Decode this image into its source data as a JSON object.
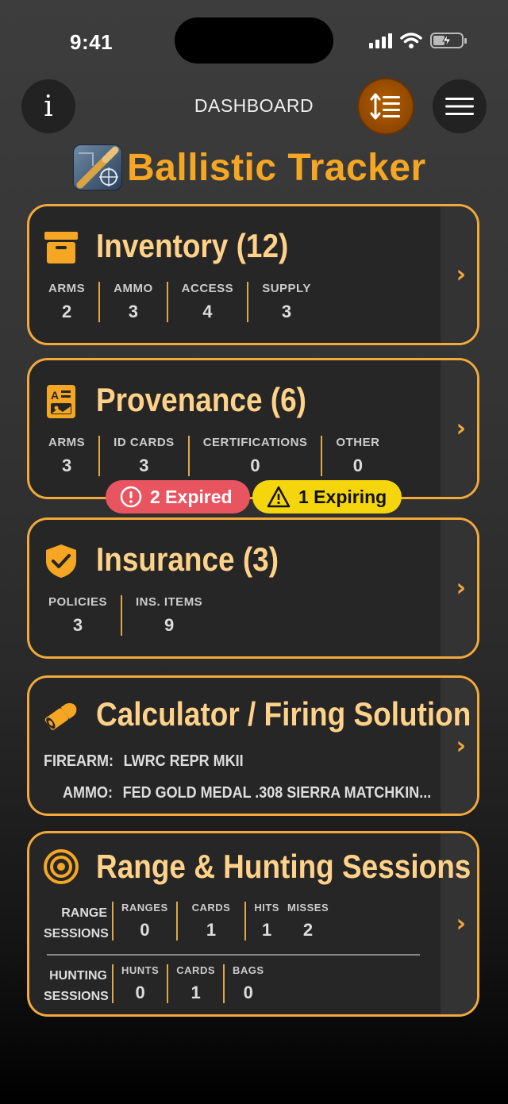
{
  "status": {
    "time": "9:41"
  },
  "nav": {
    "title": "DASHBOARD",
    "info_glyph": "i"
  },
  "app": {
    "title": "Ballistic Tracker"
  },
  "inventory": {
    "title": "Inventory (12)",
    "stats": [
      {
        "label": "ARMS",
        "value": "2"
      },
      {
        "label": "AMMO",
        "value": "3"
      },
      {
        "label": "ACCESS",
        "value": "4"
      },
      {
        "label": "SUPPLY",
        "value": "3"
      }
    ]
  },
  "provenance": {
    "title": "Provenance (6)",
    "stats": [
      {
        "label": "ARMS",
        "value": "3"
      },
      {
        "label": "ID CARDS",
        "value": "3"
      },
      {
        "label": "CERTIFICATIONS",
        "value": "0"
      },
      {
        "label": "OTHER",
        "value": "0"
      }
    ],
    "badges": {
      "expired": "2 Expired",
      "expiring": "1 Expiring"
    }
  },
  "insurance": {
    "title": "Insurance (3)",
    "stats": [
      {
        "label": "POLICIES",
        "value": "3"
      },
      {
        "label": "INS. ITEMS",
        "value": "9"
      }
    ]
  },
  "calculator": {
    "title": "Calculator / Firing Solution",
    "firearm_label": "FIREARM:",
    "firearm_value": "LWRC REPR MKII",
    "ammo_label": "AMMO:",
    "ammo_value": "FED GOLD MEDAL .308 SIERRA MATCHKIN..."
  },
  "sessions": {
    "title": "Range & Hunting Sessions",
    "range": {
      "label_line1": "RANGE",
      "label_line2": "SESSIONS",
      "stats": [
        {
          "label": "RANGES",
          "value": "0"
        },
        {
          "label": "CARDS",
          "value": "1"
        },
        {
          "label": "HITS",
          "value": "1"
        },
        {
          "label": "MISSES",
          "value": "2"
        }
      ]
    },
    "hunting": {
      "label_line1": "HUNTING",
      "label_line2": "SESSIONS",
      "stats": [
        {
          "label": "HUNTS",
          "value": "0"
        },
        {
          "label": "CARDS",
          "value": "1"
        },
        {
          "label": "BAGS",
          "value": "0"
        }
      ]
    }
  },
  "colors": {
    "accent": "#f2a93b",
    "title": "#f5a623",
    "expired": "#e85560",
    "expiring": "#f5d60c"
  },
  "icons": [
    "info-icon",
    "sort-icon",
    "hamburger-menu-icon",
    "archive-box-icon",
    "id-card-icon",
    "shield-check-icon",
    "bullet-icon",
    "target-icon",
    "chevron-right-icon",
    "alert-circle-icon",
    "warning-triangle-icon"
  ]
}
